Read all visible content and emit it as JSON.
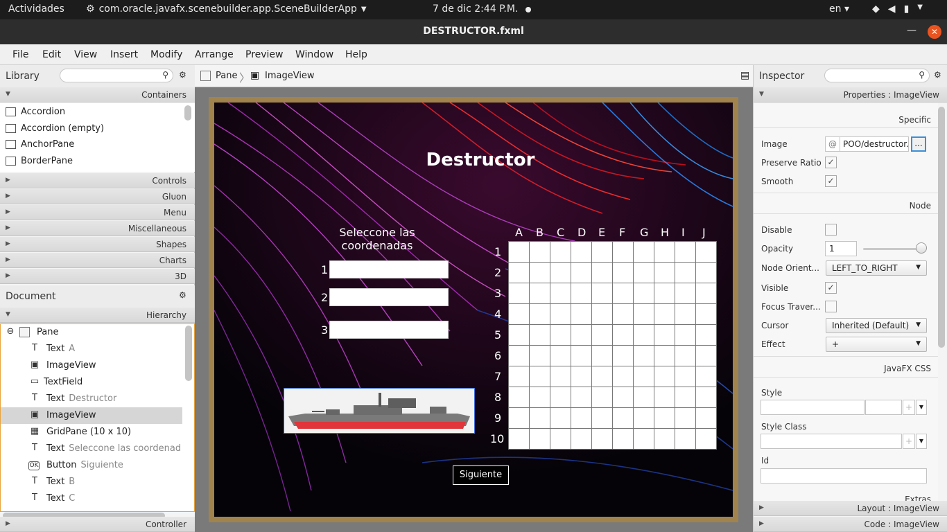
{
  "topbar": {
    "activities": "Actividades",
    "app_name": "com.oracle.javafx.scenebuilder.app.SceneBuilderApp",
    "clock": "7 de dic   2:44 P.M.",
    "lang": "en"
  },
  "window": {
    "title": "DESTRUCTOR.fxml"
  },
  "menu": [
    "File",
    "Edit",
    "View",
    "Insert",
    "Modify",
    "Arrange",
    "Preview",
    "Window",
    "Help"
  ],
  "library": {
    "title": "Library",
    "containers_label": "Containers",
    "items": [
      "Accordion",
      "Accordion  (empty)",
      "AnchorPane",
      "BorderPane"
    ],
    "sections": [
      "Controls",
      "Gluon",
      "Menu",
      "Miscellaneous",
      "Shapes",
      "Charts",
      "3D"
    ]
  },
  "document": {
    "title": "Document",
    "hierarchy_label": "Hierarchy",
    "root": "Pane",
    "nodes": [
      {
        "type": "Text",
        "sub": "A",
        "icon": "T"
      },
      {
        "type": "ImageView",
        "sub": "",
        "icon": "▣"
      },
      {
        "type": "TextField",
        "sub": "",
        "icon": "▭"
      },
      {
        "type": "Text",
        "sub": "Destructor",
        "icon": "T"
      },
      {
        "type": "ImageView",
        "sub": "",
        "icon": "▣"
      },
      {
        "type": "GridPane (10 x 10)",
        "sub": "",
        "icon": "▦"
      },
      {
        "type": "Text",
        "sub": "Seleccone las coordenad",
        "icon": "T"
      },
      {
        "type": "Button",
        "sub": "Siguiente",
        "icon": "OK"
      },
      {
        "type": "Text",
        "sub": "B",
        "icon": "T"
      },
      {
        "type": "Text",
        "sub": "C",
        "icon": "T"
      }
    ],
    "controller_label": "Controller"
  },
  "breadcrumb": {
    "first": "Pane",
    "second": "ImageView"
  },
  "canvas": {
    "heading": "Destructor",
    "prompt_line1": "Seleccone las",
    "prompt_line2": "coordenadas",
    "field_numbers": [
      "1",
      "2",
      "3"
    ],
    "columns": [
      "A",
      "B",
      "C",
      "D",
      "E",
      "F",
      "G",
      "H",
      "I",
      "J"
    ],
    "rows": [
      "1",
      "2",
      "3",
      "4",
      "5",
      "6",
      "7",
      "8",
      "9",
      "10"
    ],
    "button_label": "Siguiente"
  },
  "inspector": {
    "title": "Inspector",
    "properties_label": "Properties : ImageView",
    "specific_label": "Specific",
    "image_label": "Image",
    "image_value": "POO/destructor.",
    "image_prefix": "@",
    "browse_label": "...",
    "preserve_ratio_label": "Preserve Ratio",
    "smooth_label": "Smooth",
    "node_label": "Node",
    "disable_label": "Disable",
    "opacity_label": "Opacity",
    "opacity_value": "1",
    "node_orient_label": "Node Orient...",
    "node_orient_value": "LEFT_TO_RIGHT",
    "visible_label": "Visible",
    "focus_label": "Focus Traver...",
    "cursor_label": "Cursor",
    "cursor_value": "Inherited (Default)",
    "effect_label": "Effect",
    "effect_value": "+",
    "javafx_css_label": "JavaFX CSS",
    "style_label": "Style",
    "style_class_label": "Style Class",
    "id_label": "Id",
    "extras_label": "Extras",
    "layout_label": "Layout : ImageView",
    "code_label": "Code : ImageView"
  },
  "colors": {
    "accent": "#3b8ed8",
    "close": "#e95420",
    "selected_row": "#d6d6d6"
  }
}
